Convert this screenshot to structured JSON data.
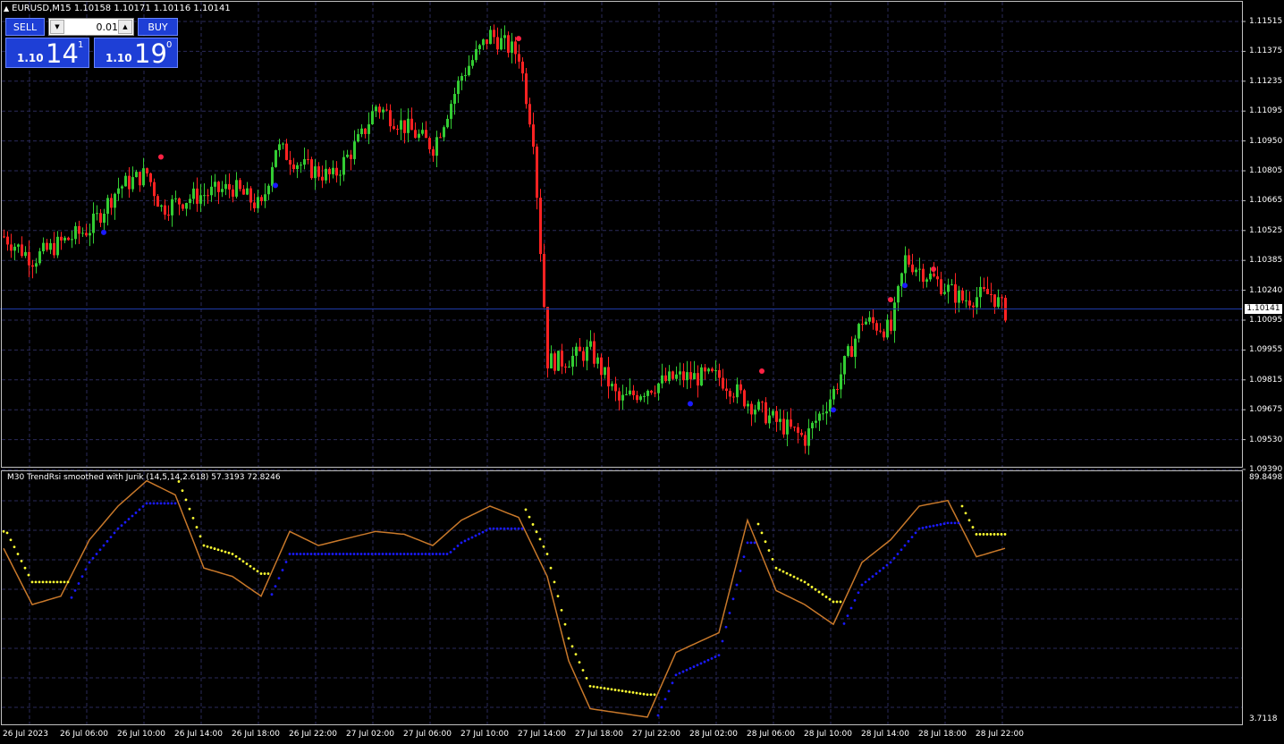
{
  "window": {
    "symbol_title": "EURUSD,M15  1.10158 1.10171 1.10116 1.10141",
    "colors": {
      "background": "#000000",
      "bull": "#33cc33",
      "bear": "#ff2222",
      "grid": "#2a2a5a",
      "rsi_line": "#c8782a",
      "dots_up": "#1a1aff",
      "dots_down": "#ffff33"
    }
  },
  "trade_panel": {
    "sell_label": "SELL",
    "buy_label": "BUY",
    "lot_value": "0.01",
    "sell_prefix": "1.10",
    "sell_big": "14",
    "sell_sup": "1",
    "buy_prefix": "1.10",
    "buy_big": "19",
    "buy_sup": "0",
    "icons": {
      "lot_down": "arrow-down-icon",
      "lot_up": "arrow-up-icon"
    }
  },
  "price_axis": {
    "labels": [
      "1.11515",
      "1.11375",
      "1.11235",
      "1.11095",
      "1.10950",
      "1.10805",
      "1.10665",
      "1.10525",
      "1.10385",
      "1.10240",
      "1.10095",
      "1.09955",
      "1.09815",
      "1.09675",
      "1.09530",
      "1.09390"
    ],
    "current_price": "1.10141"
  },
  "indicator": {
    "title": "M30 TrendRsi smoothed with Jurik (14,5,14,2.618) 57.3193 72.8246",
    "max_label": "89.8498",
    "min_label": "3.7118"
  },
  "time_axis": {
    "labels": [
      "26 Jul 2023",
      "26 Jul 06:00",
      "26 Jul 10:00",
      "26 Jul 14:00",
      "26 Jul 18:00",
      "26 Jul 22:00",
      "27 Jul 02:00",
      "27 Jul 06:00",
      "27 Jul 10:00",
      "27 Jul 14:00",
      "27 Jul 18:00",
      "27 Jul 22:00",
      "28 Jul 02:00",
      "28 Jul 06:00",
      "28 Jul 10:00",
      "28 Jul 14:00",
      "28 Jul 18:00",
      "28 Jul 22:00"
    ]
  },
  "chart_data": [
    {
      "type": "candlestick",
      "title": "EURUSD,M15",
      "ylim": [
        1.0939,
        1.1159
      ],
      "close_path": [
        {
          "t": "26 Jul 00:00",
          "v": 1.1051
        },
        {
          "t": "26 Jul 02:00",
          "v": 1.104
        },
        {
          "t": "26 Jul 04:00",
          "v": 1.1048
        },
        {
          "t": "26 Jul 06:00",
          "v": 1.1055
        },
        {
          "t": "26 Jul 08:00",
          "v": 1.1075
        },
        {
          "t": "26 Jul 10:00",
          "v": 1.1082
        },
        {
          "t": "26 Jul 11:00",
          "v": 1.1065
        },
        {
          "t": "26 Jul 13:00",
          "v": 1.107
        },
        {
          "t": "26 Jul 16:00",
          "v": 1.1075
        },
        {
          "t": "26 Jul 18:00",
          "v": 1.1065
        },
        {
          "t": "26 Jul 19:00",
          "v": 1.1095
        },
        {
          "t": "26 Jul 21:00",
          "v": 1.1085
        },
        {
          "t": "26 Jul 23:00",
          "v": 1.108
        },
        {
          "t": "27 Jul 01:00",
          "v": 1.11
        },
        {
          "t": "27 Jul 02:00",
          "v": 1.1115
        },
        {
          "t": "27 Jul 04:00",
          "v": 1.1105
        },
        {
          "t": "27 Jul 06:00",
          "v": 1.1095
        },
        {
          "t": "27 Jul 08:00",
          "v": 1.113
        },
        {
          "t": "27 Jul 09:00",
          "v": 1.114
        },
        {
          "t": "27 Jul 10:00",
          "v": 1.115
        },
        {
          "t": "27 Jul 12:00",
          "v": 1.114
        },
        {
          "t": "27 Jul 13:00",
          "v": 1.11
        },
        {
          "t": "27 Jul 14:00",
          "v": 1.099
        },
        {
          "t": "27 Jul 15:00",
          "v": 1.099
        },
        {
          "t": "27 Jul 17:00",
          "v": 1.0995
        },
        {
          "t": "27 Jul 19:00",
          "v": 1.097
        },
        {
          "t": "27 Jul 21:00",
          "v": 1.0977
        },
        {
          "t": "27 Jul 23:00",
          "v": 1.0982
        },
        {
          "t": "28 Jul 02:00",
          "v": 1.0982
        },
        {
          "t": "28 Jul 04:00",
          "v": 1.097
        },
        {
          "t": "28 Jul 06:00",
          "v": 1.096
        },
        {
          "t": "28 Jul 08:00",
          "v": 1.0952
        },
        {
          "t": "28 Jul 10:00",
          "v": 1.0975
        },
        {
          "t": "28 Jul 12:00",
          "v": 1.101
        },
        {
          "t": "28 Jul 14:00",
          "v": 1.1005
        },
        {
          "t": "28 Jul 15:00",
          "v": 1.104
        },
        {
          "t": "28 Jul 17:00",
          "v": 1.103
        },
        {
          "t": "28 Jul 19:00",
          "v": 1.102
        },
        {
          "t": "28 Jul 21:00",
          "v": 1.1023
        },
        {
          "t": "28 Jul 22:00",
          "v": 1.10141
        }
      ],
      "markers_up": [
        {
          "t": "26 Jul 07:00",
          "v": 1.1053
        },
        {
          "t": "26 Jul 19:00",
          "v": 1.1076
        },
        {
          "t": "28 Jul 00:00",
          "v": 1.0969
        },
        {
          "t": "28 Jul 10:00",
          "v": 1.0966
        },
        {
          "t": "28 Jul 15:00",
          "v": 1.1027
        }
      ],
      "markers_down": [
        {
          "t": "26 Jul 11:00",
          "v": 1.109
        },
        {
          "t": "27 Jul 12:00",
          "v": 1.1148
        },
        {
          "t": "28 Jul 05:00",
          "v": 1.0985
        },
        {
          "t": "28 Jul 14:00",
          "v": 1.102
        },
        {
          "t": "28 Jul 17:00",
          "v": 1.1035
        }
      ]
    },
    {
      "type": "line",
      "title": "M30 TrendRsi smoothed with Jurik (14,5,14,2.618) 57.3193 72.8246",
      "ylim": [
        3.7118,
        89.8498
      ],
      "series": [
        {
          "values": [
            {
              "t": "26 Jul 00:00",
              "v": 65
            },
            {
              "t": "26 Jul 02:00",
              "v": 45
            },
            {
              "t": "26 Jul 04:00",
              "v": 48
            },
            {
              "t": "26 Jul 06:00",
              "v": 68
            },
            {
              "t": "26 Jul 08:00",
              "v": 80
            },
            {
              "t": "26 Jul 10:00",
              "v": 89
            },
            {
              "t": "26 Jul 12:00",
              "v": 84
            },
            {
              "t": "26 Jul 14:00",
              "v": 58
            },
            {
              "t": "26 Jul 16:00",
              "v": 55
            },
            {
              "t": "26 Jul 18:00",
              "v": 48
            },
            {
              "t": "26 Jul 20:00",
              "v": 71
            },
            {
              "t": "26 Jul 22:00",
              "v": 66
            },
            {
              "t": "27 Jul 02:00",
              "v": 71
            },
            {
              "t": "27 Jul 04:00",
              "v": 70
            },
            {
              "t": "27 Jul 06:00",
              "v": 66
            },
            {
              "t": "27 Jul 08:00",
              "v": 75
            },
            {
              "t": "27 Jul 10:00",
              "v": 80
            },
            {
              "t": "27 Jul 12:00",
              "v": 76
            },
            {
              "t": "27 Jul 14:00",
              "v": 55
            },
            {
              "t": "27 Jul 15:30",
              "v": 25
            },
            {
              "t": "27 Jul 17:00",
              "v": 8
            },
            {
              "t": "27 Jul 21:00",
              "v": 5
            },
            {
              "t": "27 Jul 23:00",
              "v": 28
            },
            {
              "t": "28 Jul 02:00",
              "v": 35
            },
            {
              "t": "28 Jul 04:00",
              "v": 75
            },
            {
              "t": "28 Jul 06:00",
              "v": 50
            },
            {
              "t": "28 Jul 08:00",
              "v": 45
            },
            {
              "t": "28 Jul 10:00",
              "v": 38
            },
            {
              "t": "28 Jul 12:00",
              "v": 60
            },
            {
              "t": "28 Jul 14:00",
              "v": 68
            },
            {
              "t": "28 Jul 16:00",
              "v": 80
            },
            {
              "t": "28 Jul 18:00",
              "v": 82
            },
            {
              "t": "28 Jul 20:00",
              "v": 62
            },
            {
              "t": "28 Jul 22:00",
              "v": 65
            }
          ]
        }
      ]
    }
  ]
}
